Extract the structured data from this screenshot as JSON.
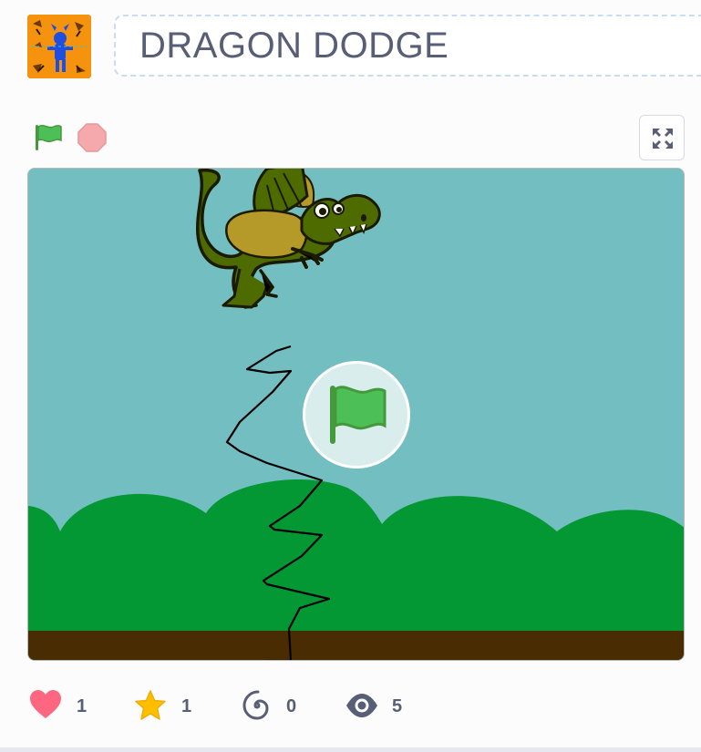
{
  "project": {
    "title": "DRAGON DODGE",
    "thumbnail_icon": "project-thumbnail"
  },
  "controls": {
    "green_flag_icon": "green-flag-icon",
    "stop_icon": "stop-icon",
    "fullscreen_icon": "fullscreen-icon"
  },
  "stage": {
    "sky_color": "#73bec0",
    "bush_color": "#039833",
    "ground_color": "#4a2c02",
    "sprite": "dragon"
  },
  "stats": {
    "loves": "1",
    "favorites": "1",
    "remixes": "0",
    "views": "5"
  },
  "colors": {
    "love": "#ff6680",
    "favorite": "#ffbf00",
    "text": "#575e75",
    "flag_green": "#4cbf56"
  }
}
